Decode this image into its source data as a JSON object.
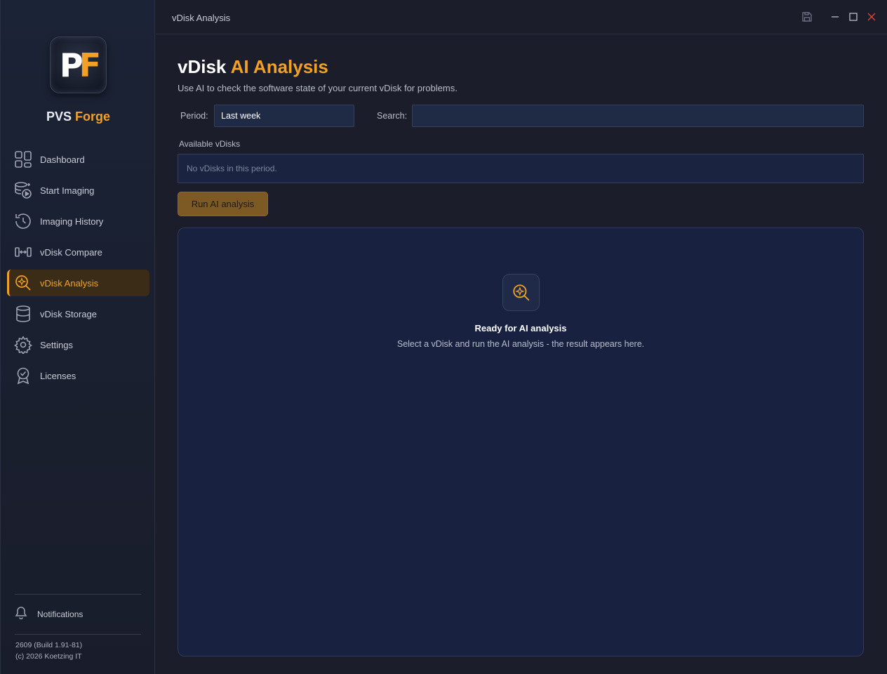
{
  "window": {
    "title": "vDisk Analysis"
  },
  "brand": {
    "logo_text_1": "P",
    "logo_text_2": "F",
    "name_1": "PVS",
    "name_2": "Forge"
  },
  "sidebar": {
    "items": [
      {
        "label": "Dashboard",
        "icon": "dashboard-icon"
      },
      {
        "label": "Start Imaging",
        "icon": "start-imaging-icon"
      },
      {
        "label": "Imaging History",
        "icon": "history-icon"
      },
      {
        "label": "vDisk Compare",
        "icon": "compare-icon"
      },
      {
        "label": "vDisk Analysis",
        "icon": "ai-search-icon",
        "active": true
      },
      {
        "label": "vDisk Storage",
        "icon": "database-icon"
      },
      {
        "label": "Settings",
        "icon": "gear-icon"
      },
      {
        "label": "Licenses",
        "icon": "license-icon"
      }
    ],
    "notifications_label": "Notifications",
    "version": "2609 (Build 1.91-81)",
    "copyright": "(c) 2026 Koetzing IT"
  },
  "page": {
    "title_1": "vDisk",
    "title_2": "AI Analysis",
    "subtitle": "Use AI to check the software state of your current vDisk for problems.",
    "period_label": "Period:",
    "period_value": "Last week",
    "search_label": "Search:",
    "search_value": "",
    "available_label": "Available vDisks",
    "empty_list_text": "No vDisks in this period.",
    "run_button": "Run AI analysis"
  },
  "result_panel": {
    "title": "Ready for AI analysis",
    "subtitle": "Select a vDisk and run the AI analysis - the result appears here."
  },
  "colors": {
    "accent": "#f3a126",
    "background": "#1b1d2b",
    "panel": "#182240",
    "close": "#e0453a"
  }
}
